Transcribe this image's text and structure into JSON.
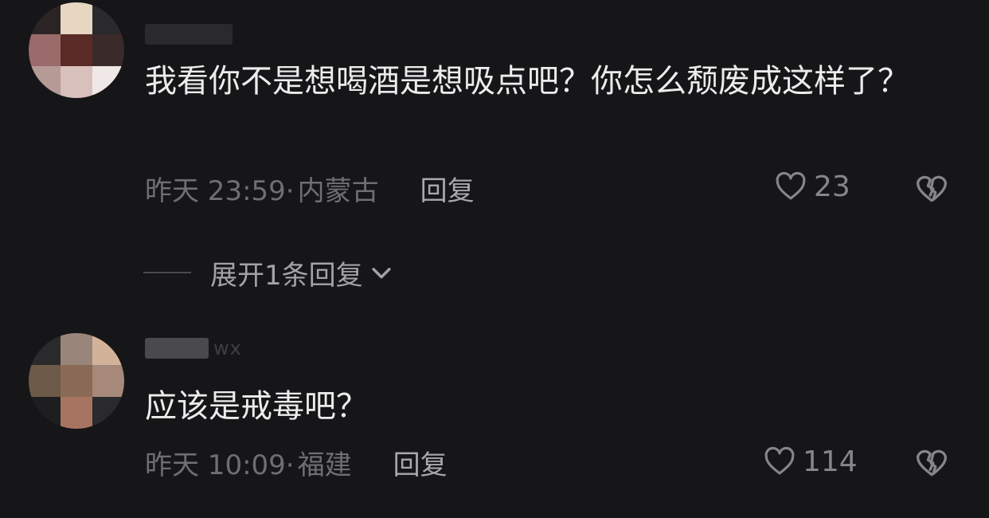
{
  "comments": [
    {
      "username": "",
      "text": "我看你不是想喝酒是想吸点吧？你怎么颓废成这样了？",
      "time": "昨天 23:59·",
      "region": "内蒙古",
      "reply_label": "回复",
      "likes": "23"
    },
    {
      "username": "wx",
      "text": "应该是戒毒吧？",
      "time": "昨天 10:09·",
      "region": "福建",
      "reply_label": "回复",
      "likes": "114"
    }
  ],
  "expand_replies": {
    "label": "展开1条回复"
  },
  "icons": {
    "like": "heart-outline-icon",
    "dislike": "broken-heart-icon",
    "expand": "chevron-down-icon"
  },
  "colors": {
    "background": "#161618",
    "text_primary": "#ececed",
    "text_secondary": "#6f6f73",
    "reply": "#a9a9ad"
  }
}
